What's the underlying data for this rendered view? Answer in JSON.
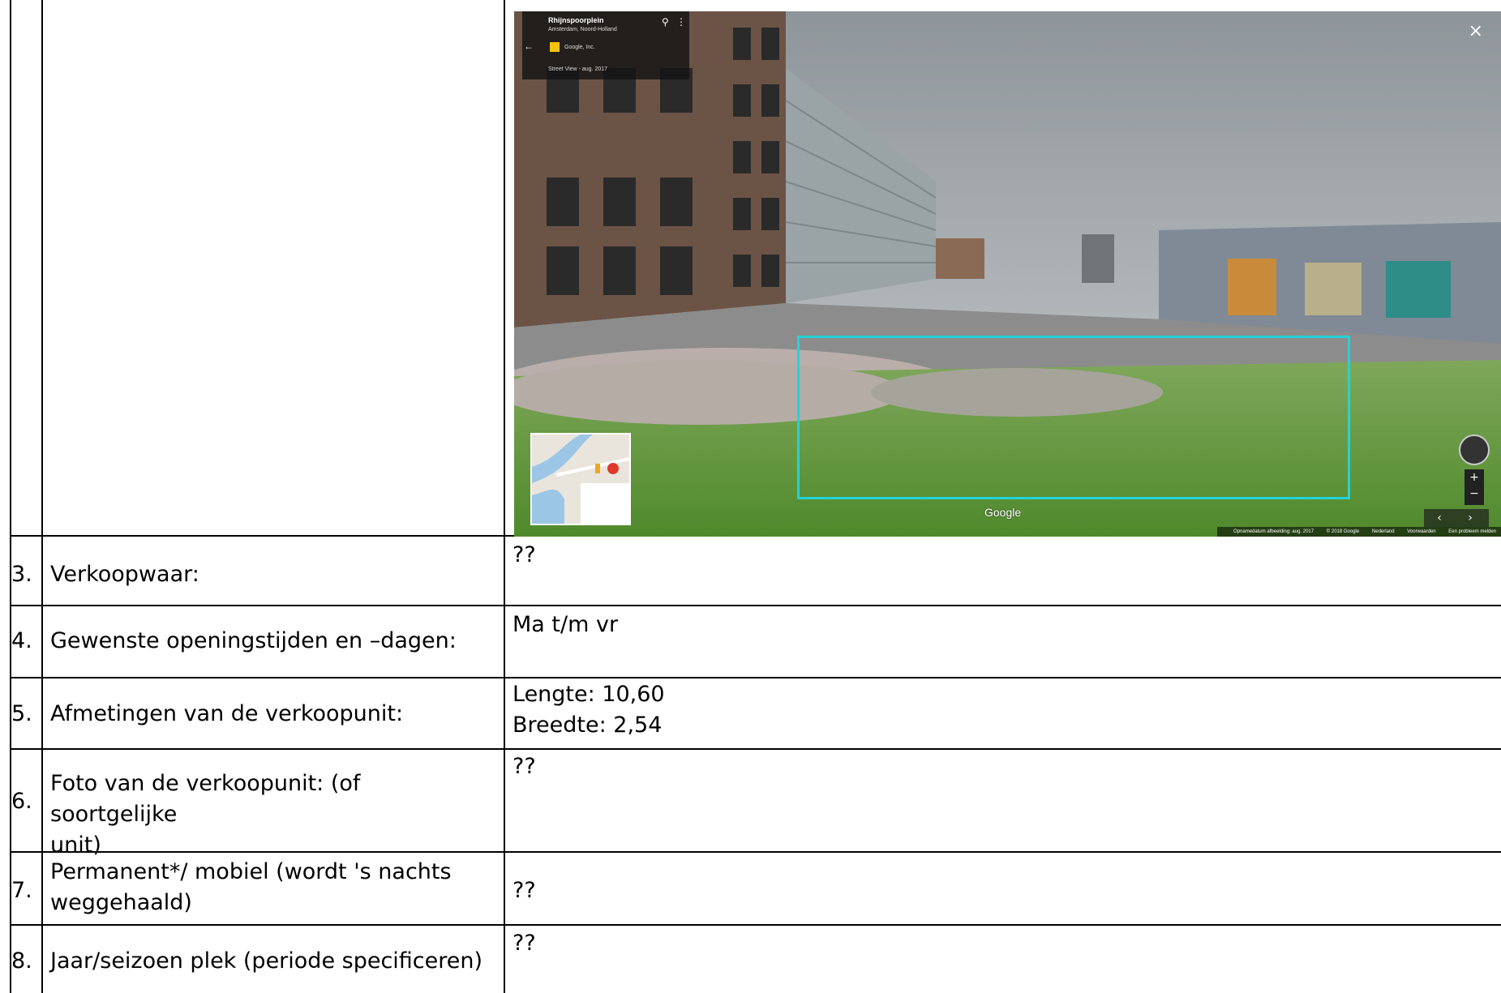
{
  "streetview": {
    "place_name": "Rhijnspoorplein",
    "place_sub": "Amsterdam, Noord-Holland",
    "owner": "Google, Inc.",
    "date": "Street View - aug. 2017",
    "google_mark": "Google",
    "footer": [
      "Opnamedatum afbeelding: aug. 2017",
      "© 2018 Google",
      "Nederland",
      "Voorwaarden",
      "Een probleem melden"
    ],
    "highlight_color": "#25d2d8"
  },
  "rows": [
    {
      "num": "3.",
      "label": "Verkoopwaar:",
      "value_lines": [
        "??"
      ]
    },
    {
      "num": "4.",
      "label": "Gewenste openingstijden en –dagen:",
      "value_lines": [
        "Ma t/m vr"
      ]
    },
    {
      "num": "5.",
      "label": "Afmetingen van de verkoopunit:",
      "value_lines": [
        "Lengte: 10,60",
        "Breedte: 2,54"
      ]
    },
    {
      "num": "6.",
      "label_lines": [
        "Foto van de verkoopunit: (of soortgelijke",
        "unit)"
      ],
      "value_lines": [
        "??"
      ]
    },
    {
      "num": "7.",
      "label_lines": [
        "Permanent*/ mobiel (wordt 's nachts",
        "weggehaald)"
      ],
      "value_lines": [
        "??"
      ]
    },
    {
      "num": "8.",
      "label": "Jaar/seizoen plek (periode specificeren)",
      "value_lines": [
        "??"
      ]
    }
  ]
}
